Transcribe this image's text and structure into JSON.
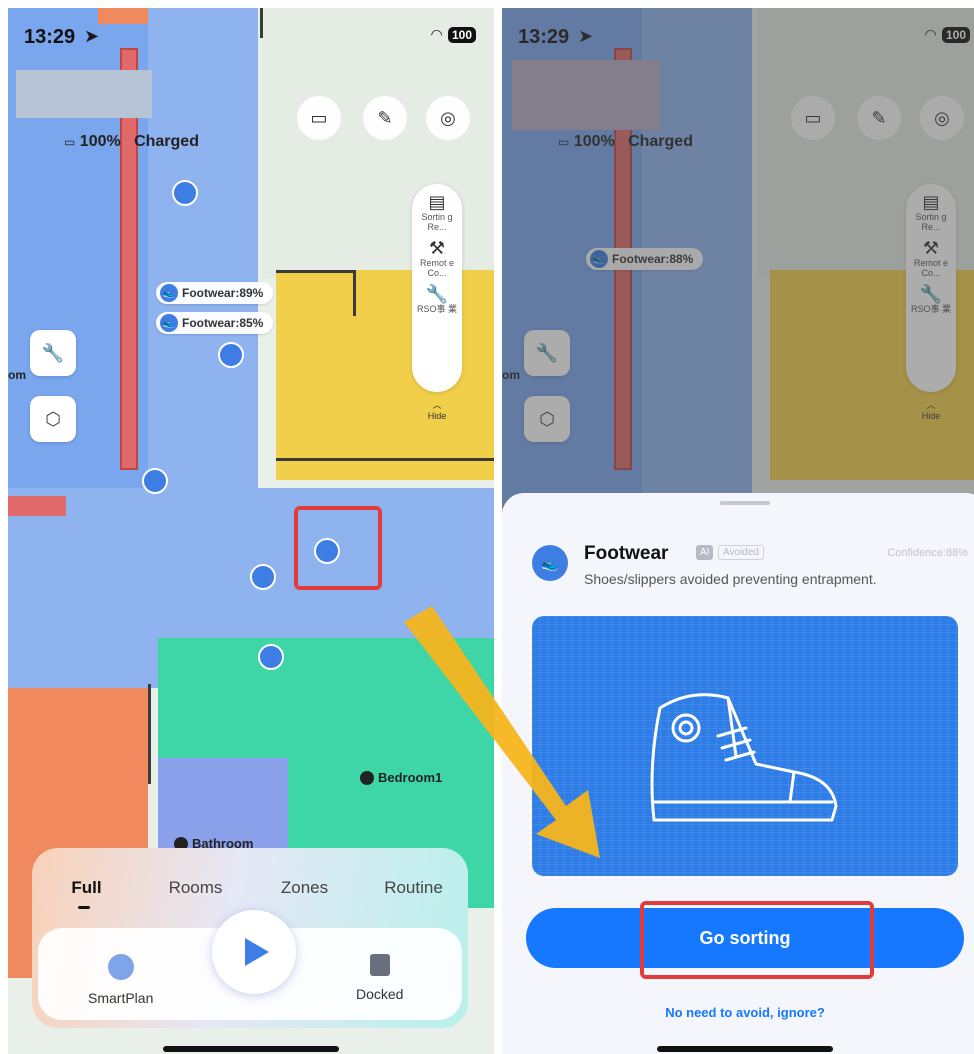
{
  "left": {
    "status_time": "13:29",
    "status_battery": "100",
    "battery_text": "100%",
    "charge_text": "Charged",
    "toolbar": [
      {
        "label": "Sortin g Re..."
      },
      {
        "label": "Remot e Co..."
      },
      {
        "label": "RSO事 業"
      }
    ],
    "hide_label": "Hide",
    "pins": [
      "Footwear:89%",
      "Footwear:85%"
    ],
    "rooms": [
      "Bedroom1",
      "Bathroom"
    ],
    "edge_left": "om",
    "tabs": [
      "Full",
      "Rooms",
      "Zones",
      "Routine"
    ],
    "controls": {
      "left_label": "SmartPlan",
      "right_label": "Docked"
    }
  },
  "right": {
    "status_time": "13:29",
    "status_battery": "100",
    "battery_text": "100%",
    "charge_text": "Charged",
    "pin": "Footwear:88%",
    "toolbar": [
      {
        "label": "Sortin g Re..."
      },
      {
        "label": "Remot e Co..."
      },
      {
        "label": "RSO事 業"
      }
    ],
    "hide_label": "Hide",
    "edge_left": "om",
    "sheet": {
      "title": "Footwear",
      "ai_tag": "AI",
      "avoided_tag": "Avoided",
      "confidence": "Confidence:88%",
      "description": "Shoes/slippers avoided preventing entrapment.",
      "primary_button": "Go sorting",
      "secondary_link": "No need to avoid, ignore?"
    }
  },
  "colors": {
    "accent_blue": "#1677ff",
    "map_blue": "#7aa6ee",
    "map_yellow": "#f2cf4a",
    "map_teal": "#3fd6a7",
    "map_orange": "#f08a5e",
    "highlight_red": "#e23b3b",
    "arrow_yellow": "#f6b51c"
  }
}
